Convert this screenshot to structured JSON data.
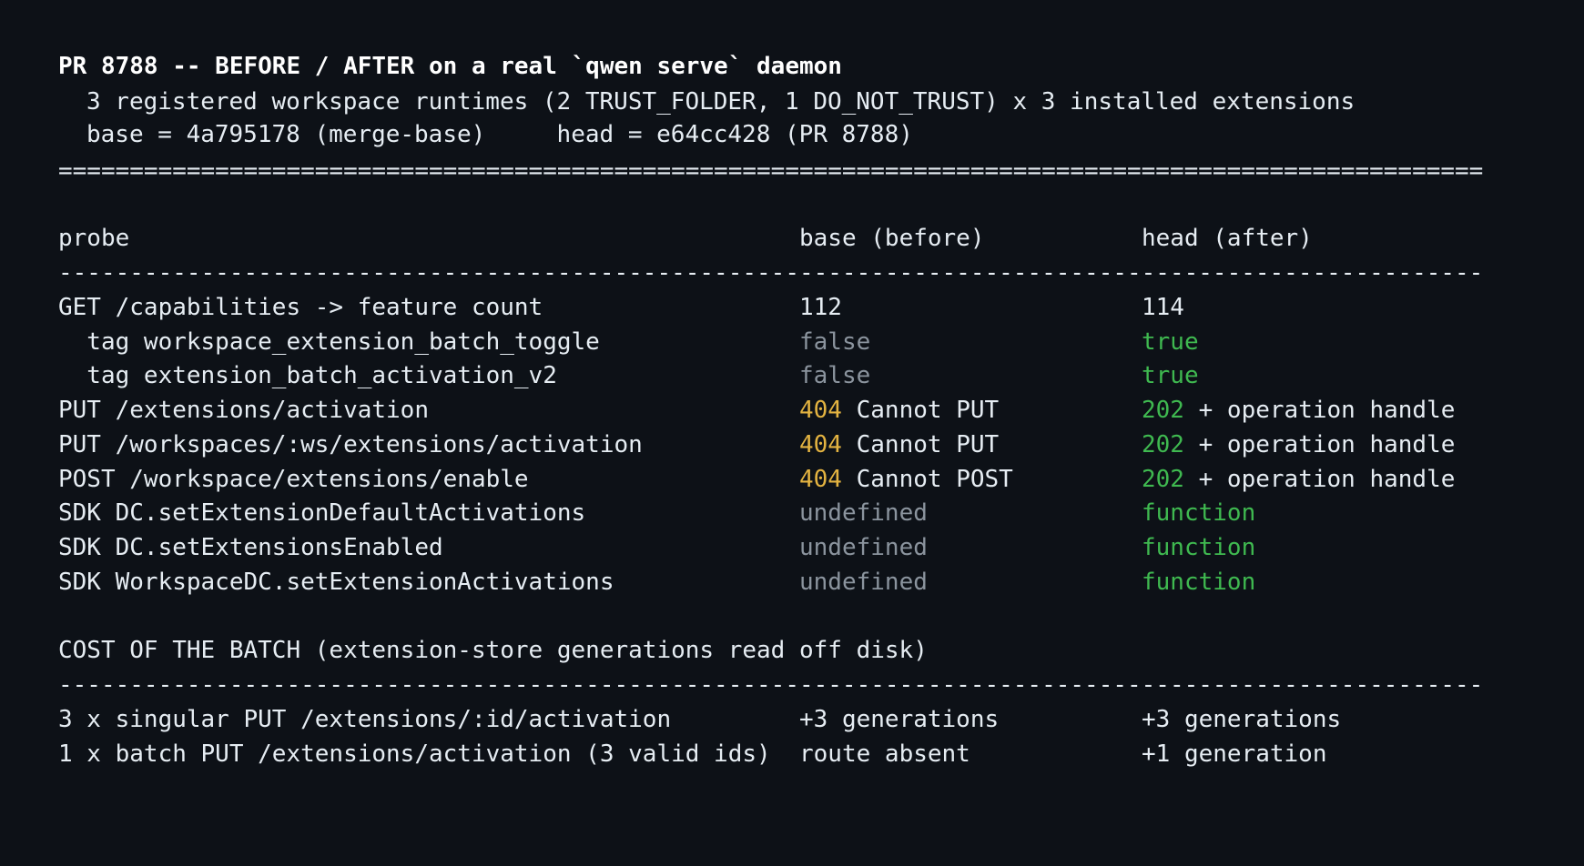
{
  "header": {
    "title": "PR 8788 -- BEFORE / AFTER on a real `qwen serve` daemon",
    "subtitle": "3 registered workspace runtimes (2 TRUST_FOLDER, 1 DO_NOT_TRUST) x 3 installed extensions",
    "refs": "base = 4a795178 (merge-base)     head = e64cc428 (PR 8788)",
    "rule_double": "======================================================================================================",
    "rule_single": "------------------------------------------------------------------------------------------------------"
  },
  "probe_table": {
    "columns": [
      "probe",
      "base (before)",
      "head (after)"
    ],
    "rows": [
      {
        "probe": "GET /capabilities -> feature count",
        "base_code": "",
        "base": "112",
        "base_style": "plain",
        "head_code": "",
        "head": "114",
        "head_style": "plain"
      },
      {
        "probe": "  tag workspace_extension_batch_toggle",
        "base_code": "",
        "base": "false",
        "base_style": "muted",
        "head_code": "",
        "head": "true",
        "head_style": "green"
      },
      {
        "probe": "  tag extension_batch_activation_v2",
        "base_code": "",
        "base": "false",
        "base_style": "muted",
        "head_code": "",
        "head": "true",
        "head_style": "green"
      },
      {
        "probe": "PUT /extensions/activation",
        "base_code": "404",
        "base": " Cannot PUT",
        "base_style": "plain",
        "head_code": "202",
        "head": " + operation handle",
        "head_style": "plain"
      },
      {
        "probe": "PUT /workspaces/:ws/extensions/activation",
        "base_code": "404",
        "base": " Cannot PUT",
        "base_style": "plain",
        "head_code": "202",
        "head": " + operation handle",
        "head_style": "plain"
      },
      {
        "probe": "POST /workspace/extensions/enable",
        "base_code": "404",
        "base": " Cannot POST",
        "base_style": "plain",
        "head_code": "202",
        "head": " + operation handle",
        "head_style": "plain"
      },
      {
        "probe": "SDK DC.setExtensionDefaultActivations",
        "base_code": "",
        "base": "undefined",
        "base_style": "muted",
        "head_code": "",
        "head": "function",
        "head_style": "green"
      },
      {
        "probe": "SDK DC.setExtensionsEnabled",
        "base_code": "",
        "base": "undefined",
        "base_style": "muted",
        "head_code": "",
        "head": "function",
        "head_style": "green"
      },
      {
        "probe": "SDK WorkspaceDC.setExtensionActivations",
        "base_code": "",
        "base": "undefined",
        "base_style": "muted",
        "head_code": "",
        "head": "function",
        "head_style": "green"
      }
    ]
  },
  "cost_section": {
    "heading": "COST OF THE BATCH (extension-store generations read off disk)",
    "rows": [
      {
        "probe": "3 x singular PUT /extensions/:id/activation",
        "base": "+3 generations",
        "head": "+3 generations"
      },
      {
        "probe": "1 x batch PUT /extensions/activation (3 valid ids)",
        "base": "route absent",
        "head": "+1 generation"
      }
    ]
  },
  "colors": {
    "background": "#0d1117",
    "text": "#e6edf3",
    "muted": "#8b949e",
    "success": "#3fb950",
    "status_code_before": "#e3b341",
    "status_code_after": "#3fb950"
  }
}
